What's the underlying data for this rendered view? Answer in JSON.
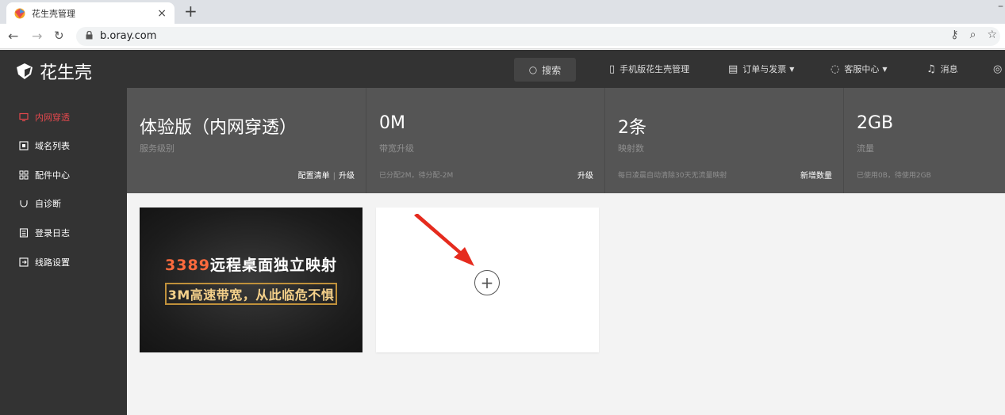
{
  "browser": {
    "tab_title": "花生壳管理",
    "tab_close": "×",
    "new_tab": "+",
    "url": "b.oray.com"
  },
  "header": {
    "logo_text": "花生壳",
    "search_label": "搜索",
    "mobile_label": "手机版花生壳管理",
    "orders_label": "订单与发票",
    "support_label": "客服中心",
    "messages_label": "消息"
  },
  "sidebar": {
    "items": [
      {
        "label": "内网穿透",
        "icon": "monitor-icon",
        "active": true
      },
      {
        "label": "域名列表",
        "icon": "list-icon"
      },
      {
        "label": "配件中心",
        "icon": "grid-icon"
      },
      {
        "label": "自诊断",
        "icon": "diagnose-icon"
      },
      {
        "label": "登录日志",
        "icon": "log-icon"
      },
      {
        "label": "线路设置",
        "icon": "route-icon"
      }
    ]
  },
  "stats": [
    {
      "value": "体验版（内网穿透）",
      "label": "服务级别",
      "note": "",
      "action": "配置清单",
      "action2": "升级"
    },
    {
      "value": "0M",
      "label": "带宽升级",
      "note": "已分配2M，待分配-2M",
      "action": "升级"
    },
    {
      "value": "2条",
      "label": "映射数",
      "note": "每日凌晨自动清除30天无流量映射",
      "action": "新增数量"
    },
    {
      "value": "2GB",
      "label": "流量",
      "note": "已使用0B，待使用2GB",
      "action": ""
    }
  ],
  "banner": {
    "num": "3389",
    "headline": "远程桌面独立映射",
    "subline": "3M高速带宽，从此临危不惧"
  },
  "add_card": {
    "add_symbol": "+"
  },
  "colors": {
    "header_bg": "#333333",
    "stats_bg": "#555555",
    "active": "#e5484d",
    "arrow": "#e52b1e"
  }
}
